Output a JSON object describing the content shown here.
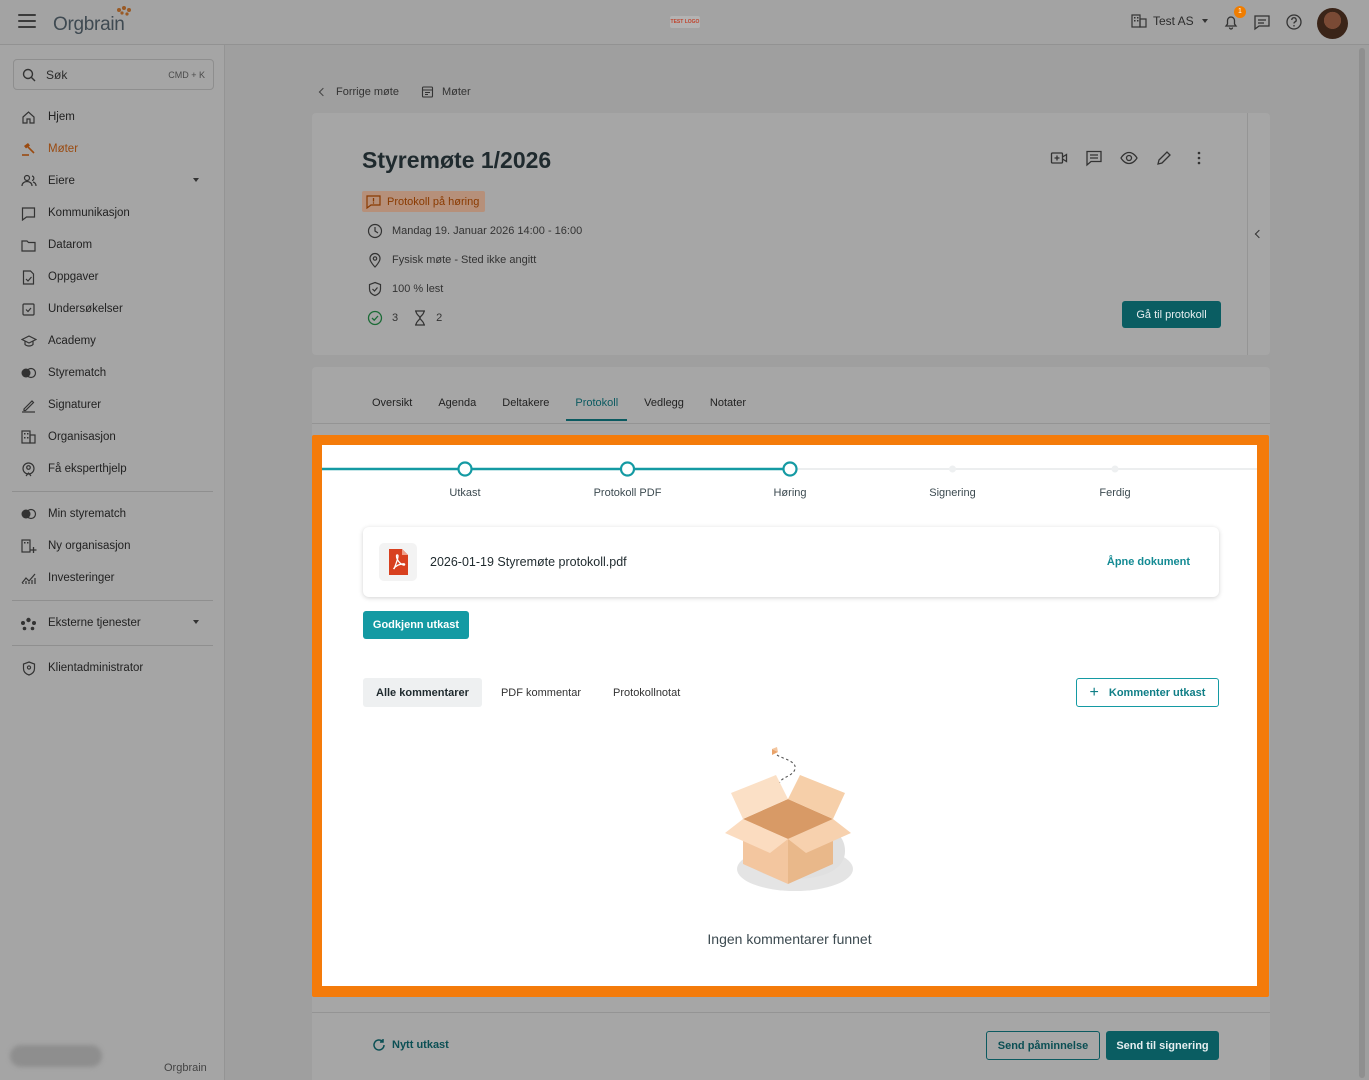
{
  "header": {
    "logo": "Orgbrain",
    "test_logo": "TEST LOGO",
    "org_name": "Test AS",
    "notification_count": "1"
  },
  "sidebar": {
    "search_placeholder": "Søk",
    "search_shortcut": "CMD + K",
    "items": [
      {
        "label": "Hjem",
        "icon": "home-icon"
      },
      {
        "label": "Møter",
        "icon": "gavel-icon",
        "active": true
      },
      {
        "label": "Eiere",
        "icon": "people-icon",
        "expandable": true
      },
      {
        "label": "Kommunikasjon",
        "icon": "chat-icon"
      },
      {
        "label": "Datarom",
        "icon": "folder-icon"
      },
      {
        "label": "Oppgaver",
        "icon": "task-icon"
      },
      {
        "label": "Undersøkelser",
        "icon": "survey-icon"
      },
      {
        "label": "Academy",
        "icon": "graduation-icon"
      },
      {
        "label": "Styrematch",
        "icon": "match-icon"
      },
      {
        "label": "Signaturer",
        "icon": "signature-icon"
      },
      {
        "label": "Organisasjon",
        "icon": "building-icon"
      },
      {
        "label": "Få eksperthjelp",
        "icon": "expert-icon"
      }
    ],
    "items2": [
      {
        "label": "Min styrematch",
        "icon": "match-icon"
      },
      {
        "label": "Ny organisasjon",
        "icon": "add-building-icon"
      },
      {
        "label": "Investeringer",
        "icon": "chart-icon"
      }
    ],
    "items3": [
      {
        "label": "Eksterne tjenester",
        "icon": "services-icon",
        "expandable": true
      }
    ],
    "items4": [
      {
        "label": "Klientadministrator",
        "icon": "shield-icon"
      }
    ],
    "footer_logo": "Orgbrain"
  },
  "breadcrumb": {
    "prev": "Forrige møte",
    "meetings": "Møter"
  },
  "meeting": {
    "title": "Styremøte 1/2026",
    "status": "Protokoll på høring",
    "datetime": "Mandag 19. Januar 2026 14:00 - 16:00",
    "location": "Fysisk møte - Sted ikke angitt",
    "read": "100 % lest",
    "approved_count": "3",
    "pending_count": "2",
    "goto_protocol": "Gå til protokoll"
  },
  "tabs": [
    "Oversikt",
    "Agenda",
    "Deltakere",
    "Protokoll",
    "Vedlegg",
    "Notater"
  ],
  "active_tab": "Protokoll",
  "stepper": {
    "steps": [
      "Utkast",
      "Protokoll PDF",
      "Høring",
      "Signering",
      "Ferdig"
    ],
    "completed": 3
  },
  "document": {
    "filename": "2026-01-19 Styremøte protokoll.pdf",
    "open_label": "Åpne dokument"
  },
  "approve_label": "Godkjenn utkast",
  "comment_tabs": [
    "Alle kommentarer",
    "PDF kommentar",
    "Protokollnotat"
  ],
  "comment_button": "Kommenter utkast",
  "empty_message": "Ingen kommentarer funnet",
  "footer": {
    "new_draft": "Nytt utkast",
    "send_reminder": "Send påminnelse",
    "send_signing": "Send til signering"
  },
  "colors": {
    "accent": "#149aa3",
    "dark_accent": "#0a5d62",
    "highlight": "#f47b0a"
  }
}
